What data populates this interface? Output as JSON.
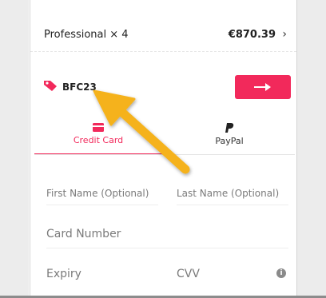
{
  "order_summary": {
    "product": "Professional × 4",
    "price": "€870.39",
    "chevron": "›"
  },
  "coupon": {
    "icon": "tag-icon",
    "code": "BFC23",
    "apply_icon": "arrow-right-icon"
  },
  "payment_tabs": [
    {
      "label": "Credit Card",
      "icon": "credit-card-icon",
      "active": true
    },
    {
      "label": "PayPal",
      "icon": "paypal-icon",
      "active": false
    }
  ],
  "form": {
    "first_name_placeholder": "First Name (Optional)",
    "last_name_placeholder": "Last Name (Optional)",
    "card_number_placeholder": "Card Number",
    "expiry_placeholder": "Expiry",
    "cvv_placeholder": "CVV",
    "cvv_info_icon": "info-icon"
  },
  "colors": {
    "accent": "#f2295b",
    "annotation": "#f5b21a"
  }
}
